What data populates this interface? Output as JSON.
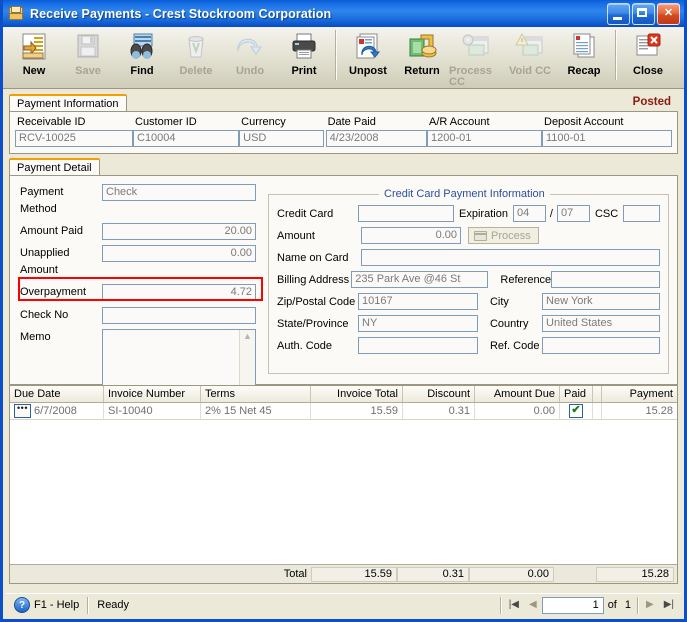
{
  "window": {
    "title": "Receive Payments - Crest Stockroom Corporation",
    "icon": "document-payment-icon",
    "buttons": {
      "minimize": "minimize-button",
      "maximize": "maximize-button",
      "close": "close-button"
    }
  },
  "toolbar": {
    "items": [
      {
        "label": "New",
        "icon": "new-document-icon",
        "disabled": false
      },
      {
        "label": "Save",
        "icon": "floppy-disk-icon",
        "disabled": true
      },
      {
        "label": "Find",
        "icon": "binoculars-icon",
        "disabled": false
      },
      {
        "label": "Delete",
        "icon": "trash-can-icon",
        "disabled": true
      },
      {
        "label": "Undo",
        "icon": "undo-arrow-icon",
        "disabled": true
      },
      {
        "label": "Print",
        "icon": "printer-icon",
        "disabled": false
      },
      {
        "label": "Unpost",
        "icon": "unpost-icon",
        "disabled": false
      },
      {
        "label": "Return",
        "icon": "return-money-icon",
        "disabled": false
      },
      {
        "label": "Process CC",
        "icon": "process-cc-icon",
        "disabled": true
      },
      {
        "label": "Void CC",
        "icon": "void-cc-icon",
        "disabled": true
      },
      {
        "label": "Recap",
        "icon": "recap-report-icon",
        "disabled": false
      },
      {
        "label": "Close",
        "icon": "close-window-icon",
        "disabled": false
      }
    ]
  },
  "payment_information": {
    "tab_label": "Payment Information",
    "status_badge": "Posted",
    "fields": [
      {
        "label": "Receivable ID",
        "value": "RCV-10025"
      },
      {
        "label": "Customer ID",
        "value": "C10004"
      },
      {
        "label": "Currency",
        "value": "USD"
      },
      {
        "label": "Date Paid",
        "value": "4/23/2008"
      },
      {
        "label": "A/R Account",
        "value": "1200-01"
      },
      {
        "label": "Deposit Account",
        "value": "1100-01"
      }
    ]
  },
  "payment_detail": {
    "tab_label": "Payment Detail",
    "left_fields": [
      {
        "label": "Payment Method",
        "value": "Check",
        "align": "left"
      },
      {
        "label": "Amount Paid",
        "value": "20.00",
        "align": "right"
      },
      {
        "label": "Unapplied Amount",
        "value": "0.00",
        "align": "right"
      },
      {
        "label": "Overpayment",
        "value": "4.72",
        "align": "right"
      },
      {
        "label": "Check No",
        "value": "",
        "align": "left"
      }
    ],
    "memo_label": "Memo",
    "memo_value": "",
    "highlight_color": "#FF0000"
  },
  "credit_card": {
    "legend": "Credit Card Payment Information",
    "labels": {
      "credit_card": "Credit Card",
      "expiration": "Expiration",
      "slash": "/",
      "csc": "CSC",
      "amount": "Amount",
      "process": "Process",
      "name_on_card": "Name on Card",
      "billing_address": "Billing Address",
      "reference": "Reference",
      "zip": "Zip/Postal Code",
      "city": "City",
      "state": "State/Province",
      "country": "Country",
      "auth_code": "Auth. Code",
      "ref_code": "Ref. Code"
    },
    "values": {
      "credit_card": "",
      "expiration_month": "04",
      "expiration_year": "07",
      "csc": "",
      "amount": "0.00",
      "name_on_card": "",
      "billing_address": "235 Park Ave @46 St",
      "reference": "",
      "zip": "10167",
      "city": "New York",
      "state": "NY",
      "country": "United States",
      "auth_code": "",
      "ref_code": ""
    }
  },
  "grid": {
    "columns": [
      "Due Date",
      "Invoice Number",
      "Terms",
      "Invoice Total",
      "Discount",
      "Amount Due",
      "Paid",
      "",
      "Payment"
    ],
    "rows": [
      {
        "due_date": "6/7/2008",
        "invoice_number": "SI-10040",
        "terms": "2% 15 Net 45",
        "invoice_total": "15.59",
        "discount": "0.31",
        "amount_due": "0.00",
        "paid": true,
        "payment": "15.28"
      }
    ],
    "total_label": "Total",
    "totals": {
      "invoice_total": "15.59",
      "discount": "0.31",
      "amount_due": "0.00",
      "payment": "15.28"
    }
  },
  "status_bar": {
    "help": "F1 - Help",
    "state": "Ready",
    "page_current": "1",
    "of_label": "of",
    "page_total": "1",
    "nav": {
      "first": "first-record-button",
      "prev": "previous-record-button",
      "next": "next-record-button",
      "last": "last-record-button"
    }
  },
  "colors": {
    "title_bar": "#0B50C8",
    "posted": "#8B1A11",
    "highlight": "#FF0000",
    "legend": "#2B4F9E",
    "tab_accent": "#F0A000"
  }
}
